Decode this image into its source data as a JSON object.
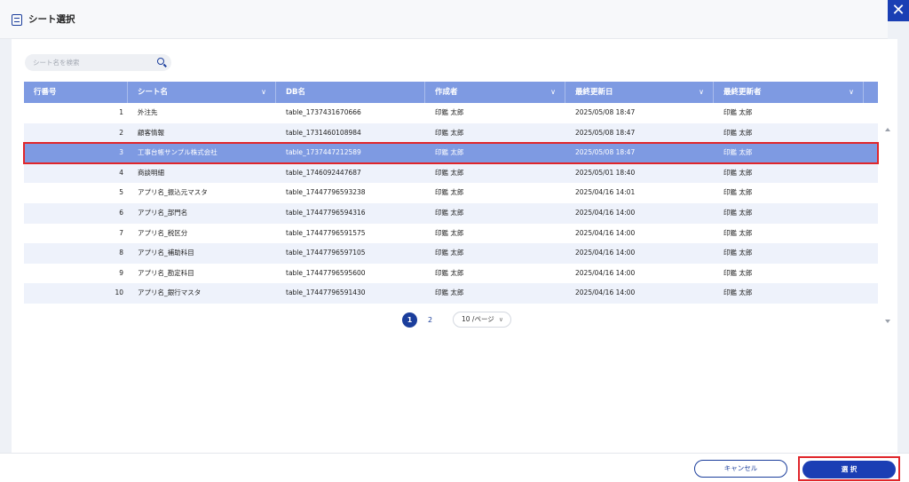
{
  "window": {
    "title": "シート選択",
    "title_icon": "sheet-list-icon",
    "close_icon": "close-icon",
    "close_glyph": "✕"
  },
  "search": {
    "placeholder": "シート名を検索",
    "icon": "search-icon"
  },
  "table": {
    "columns": [
      {
        "label": "行番号",
        "sortable": false
      },
      {
        "label": "シート名",
        "sortable": true
      },
      {
        "label": "DB名",
        "sortable": false
      },
      {
        "label": "作成者",
        "sortable": true
      },
      {
        "label": "最終更新日",
        "sortable": true
      },
      {
        "label": "最終更新者",
        "sortable": true
      }
    ],
    "chevron_glyph": "∨",
    "selected_index": 2,
    "rows": [
      {
        "no": "1",
        "sheet": "外注先",
        "db": "table_1737431670666",
        "creator": "印鑑 太郎",
        "updated": "2025/05/08 18:47",
        "updater": "印鑑 太郎"
      },
      {
        "no": "2",
        "sheet": "顧客情報",
        "db": "table_1731460108984",
        "creator": "印鑑 太郎",
        "updated": "2025/05/08 18:47",
        "updater": "印鑑 太郎"
      },
      {
        "no": "3",
        "sheet": "工事台帳サンプル株式会社",
        "db": "table_1737447212589",
        "creator": "印鑑 太郎",
        "updated": "2025/05/08 18:47",
        "updater": "印鑑 太郎"
      },
      {
        "no": "4",
        "sheet": "商談明細",
        "db": "table_1746092447687",
        "creator": "印鑑 太郎",
        "updated": "2025/05/01 18:40",
        "updater": "印鑑 太郎"
      },
      {
        "no": "5",
        "sheet": "アプリ名_振込元マスタ",
        "db": "table_17447796593238",
        "creator": "印鑑 太郎",
        "updated": "2025/04/16 14:01",
        "updater": "印鑑 太郎"
      },
      {
        "no": "6",
        "sheet": "アプリ名_部門名",
        "db": "table_17447796594316",
        "creator": "印鑑 太郎",
        "updated": "2025/04/16 14:00",
        "updater": "印鑑 太郎"
      },
      {
        "no": "7",
        "sheet": "アプリ名_税区分",
        "db": "table_17447796591575",
        "creator": "印鑑 太郎",
        "updated": "2025/04/16 14:00",
        "updater": "印鑑 太郎"
      },
      {
        "no": "8",
        "sheet": "アプリ名_補助科目",
        "db": "table_17447796597105",
        "creator": "印鑑 太郎",
        "updated": "2025/04/16 14:00",
        "updater": "印鑑 太郎"
      },
      {
        "no": "9",
        "sheet": "アプリ名_勘定科目",
        "db": "table_17447796595600",
        "creator": "印鑑 太郎",
        "updated": "2025/04/16 14:00",
        "updater": "印鑑 太郎"
      },
      {
        "no": "10",
        "sheet": "アプリ名_銀行マスタ",
        "db": "table_17447796591430",
        "creator": "印鑑 太郎",
        "updated": "2025/04/16 14:00",
        "updater": "印鑑 太郎"
      }
    ]
  },
  "pagination": {
    "pages": [
      "1",
      "2"
    ],
    "current": "1",
    "page_size_label": "10 /ページ",
    "chevron_glyph": "∨"
  },
  "footer": {
    "cancel_label": "キャンセル",
    "select_label": "選 択"
  },
  "colors": {
    "accent": "#1b3eb4",
    "header_bg": "#7e9ae2",
    "selected_row": "#7e9ae2",
    "highlight_border": "#e0262b"
  }
}
